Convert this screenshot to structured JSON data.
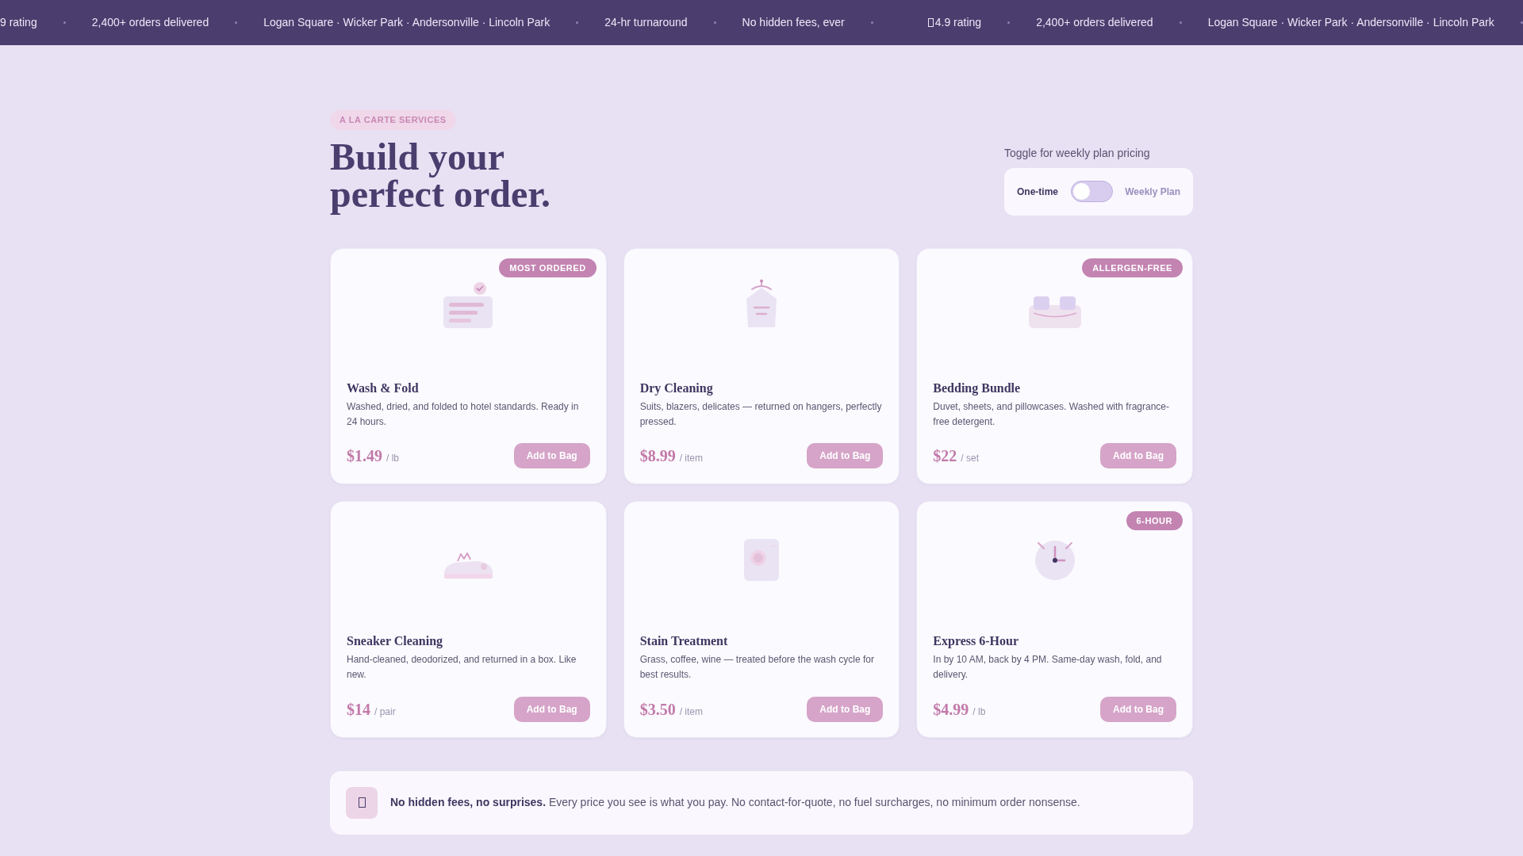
{
  "ticker": [
    {
      "text": "9 rating",
      "icon": false
    },
    {
      "text": "2,400+ orders delivered",
      "icon": false
    },
    {
      "text": "Logan Square · Wicker Park · Andersonville · Lincoln Park",
      "icon": false
    },
    {
      "text": "24-hr turnaround",
      "icon": false
    },
    {
      "text": "No hidden fees, ever",
      "icon": false
    },
    {
      "text": "4.9 rating",
      "icon": true
    },
    {
      "text": "2,400+ orders delivered",
      "icon": false
    },
    {
      "text": "Logan Square · Wicker Park · Andersonville · Lincoln Park",
      "icon": false
    }
  ],
  "eyebrow": "A LA CARTE SERVICES",
  "heading": "Build your perfect order.",
  "plan_toggle": {
    "caption": "Toggle for weekly plan pricing",
    "left_label": "One-time",
    "right_label": "Weekly Plan",
    "on": false
  },
  "services": [
    {
      "title": "Wash & Fold",
      "description": "Washed, dried, and folded to hotel standards. Ready in 24 hours.",
      "price": "$1.49",
      "unit": "/ lb",
      "badge": "MOST ORDERED",
      "button": "Add to Bag"
    },
    {
      "title": "Dry Cleaning",
      "description": "Suits, blazers, delicates — returned on hangers, perfectly pressed.",
      "price": "$8.99",
      "unit": "/ item",
      "button": "Add to Bag"
    },
    {
      "title": "Bedding Bundle",
      "description": "Duvet, sheets, and pillowcases. Washed with fragrance-free detergent.",
      "price": "$22",
      "unit": "/ set",
      "badge": "ALLERGEN-FREE",
      "button": "Add to Bag"
    },
    {
      "title": "Sneaker Cleaning",
      "description": "Hand-cleaned, deodorized, and returned in a box. Like new.",
      "price": "$14",
      "unit": "/ pair",
      "button": "Add to Bag"
    },
    {
      "title": "Stain Treatment",
      "description": "Grass, coffee, wine — treated before the wash cycle for best results.",
      "price": "$3.50",
      "unit": "/ item",
      "button": "Add to Bag"
    },
    {
      "title": "Express 6-Hour",
      "description": "In by 10 AM, back by 4 PM. Same-day wash, fold, and delivery.",
      "price": "$4.99",
      "unit": "/ lb",
      "badge": "6-HOUR",
      "button": "Add to Bag"
    }
  ],
  "banner": {
    "text": "**No hidden fees, no surprises.** Every price you see is what you pay. No contact-for-quote, no fuel surcharges, no minimum order nonsense."
  }
}
